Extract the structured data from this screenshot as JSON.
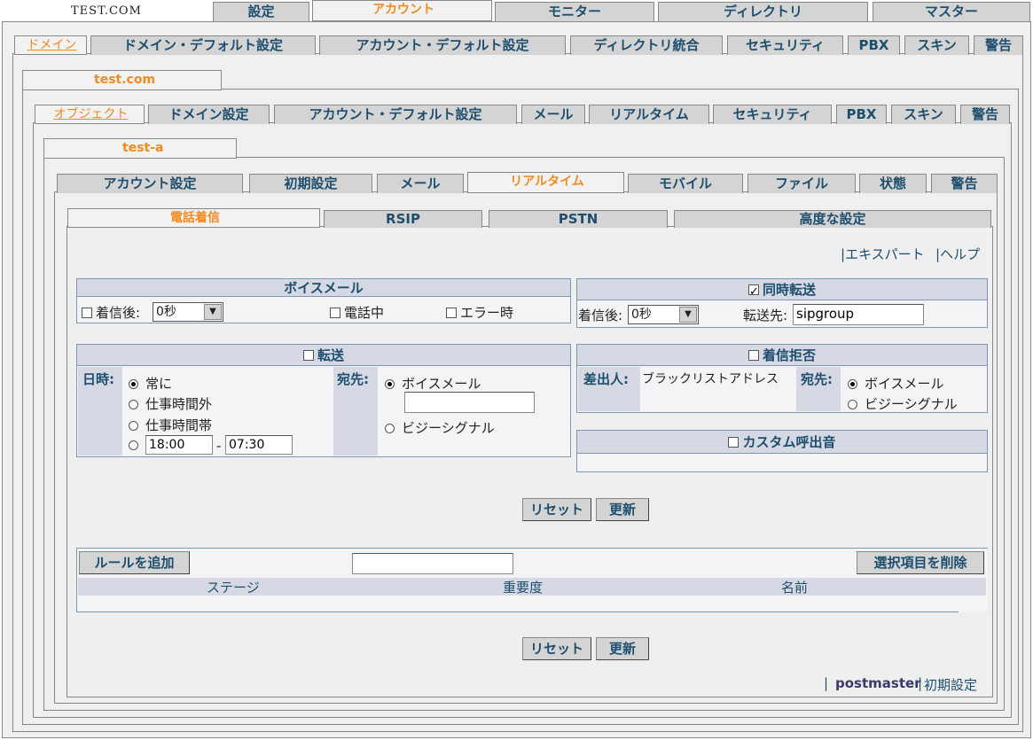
{
  "domain_label": "TEST.COM",
  "top_tabs": [
    "設定",
    "アカウント",
    "モニター",
    "ディレクトリ",
    "マスター"
  ],
  "domain_tabs": [
    "ドメイン",
    "ドメイン・デフォルト設定",
    "アカウント・デフォルト設定",
    "ディレクトリ統合",
    "セキュリティ",
    "PBX",
    "スキン",
    "警告"
  ],
  "domain_name": "test.com",
  "object_tabs": [
    "オブジェクト",
    "ドメイン設定",
    "アカウント・デフォルト設定",
    "メール",
    "リアルタイム",
    "セキュリティ",
    "PBX",
    "スキン",
    "警告"
  ],
  "account_name": "test-a",
  "account_tabs": [
    "アカウント設定",
    "初期設定",
    "メール",
    "リアルタイム",
    "モバイル",
    "ファイル",
    "状態",
    "警告"
  ],
  "rt_tabs": [
    "電話着信",
    "RSIP",
    "PSTN",
    "高度な設定"
  ],
  "links": {
    "expert": "エキスパート",
    "help": "ヘルプ"
  },
  "voicemail": {
    "title": "ボイスメール",
    "after_label": "着信後:",
    "after_value": "0秒",
    "busy": "電話中",
    "error": "エラー時"
  },
  "simul": {
    "title": "同時転送",
    "after_label": "着信後:",
    "after_value": "0秒",
    "dest_label": "転送先:",
    "dest_value": "sipgroup"
  },
  "forward": {
    "title": "転送",
    "when_label": "日時:",
    "always": "常に",
    "outside": "仕事時間外",
    "inside": "仕事時間帯",
    "from": "18:00",
    "dash": "-",
    "to": "07:30",
    "dest_label": "宛先:",
    "voicemail": "ボイスメール",
    "custom_value": "",
    "busy_signal": "ビジーシグナル"
  },
  "reject": {
    "title": "着信拒否",
    "caller_label": "差出人:",
    "caller_value": "ブラックリストアドレス",
    "dest_label": "宛先:",
    "voicemail": "ボイスメール",
    "busy_signal": "ビジーシグナル"
  },
  "ringtone": {
    "title": "カスタム呼出音"
  },
  "buttons": {
    "reset": "リセット",
    "update": "更新",
    "add_rule": "ルールを追加",
    "delete_selected": "選択項目を削除"
  },
  "rule_input": "",
  "rules_table": {
    "columns": [
      "ステージ",
      "重要度",
      "名前"
    ]
  },
  "footer": {
    "sep": "|",
    "user": "postmaster",
    "prefs": "初期設定"
  }
}
